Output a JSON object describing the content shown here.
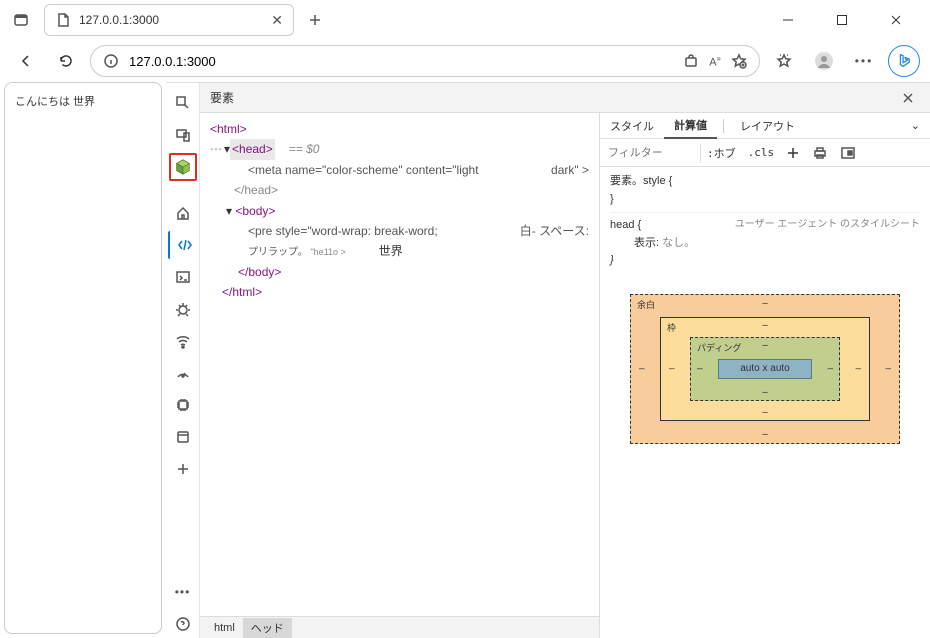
{
  "titlebar": {
    "tab_title": "127.0.0.1:3000"
  },
  "toolbar": {
    "url": "127.0.0.1:3000"
  },
  "page": {
    "hello": "こんにちは 世界"
  },
  "devtools": {
    "header_title": "要素",
    "breadcrumb": {
      "html": "html",
      "head": "ヘッド"
    },
    "tree": {
      "html_open": "<html>",
      "ellipsis": "⋯",
      "head_open": "<head>",
      "selmark": "== $0",
      "meta": "<meta name=\"color-scheme\" content=\"light",
      "meta_tail": "dark\" >",
      "head_close": "</head>",
      "body_open": "<body>",
      "pre": "<pre style=\"word-wrap: break-word;",
      "pre_tail": "白-   スペース:",
      "pre2a": "プリラップ。",
      "pre2b": "\"he11o >",
      "pre2c": "世界",
      "body_close": "</body>",
      "html_close": "</html>"
    },
    "styles": {
      "tabs": {
        "style": "スタイル",
        "computed": "計算値",
        "layout": "レイアウト"
      },
      "filter_ph": "フィルター",
      "hov": ":ホブ",
      "cls": ".cls",
      "rule1": "要素。style {",
      "rule1_close": "}",
      "rule2": "head {",
      "rule2_src": "ユーザー エージェント のスタイルシート",
      "prop_display": "表示:",
      "prop_display_v": "なし。",
      "rule2_close": "}"
    },
    "boxmodel": {
      "margin": "余白",
      "border": "枠",
      "padding": "パディング",
      "content": "auto x auto",
      "dash": "–"
    }
  }
}
